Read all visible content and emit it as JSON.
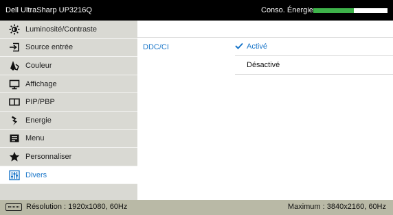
{
  "header": {
    "model": "Dell UltraSharp UP3216Q",
    "energy_label": "Conso. Énergie",
    "energy_level_percent": 55
  },
  "sidebar": {
    "items": [
      {
        "label": "Luminosité/Contraste",
        "icon": "brightness-icon"
      },
      {
        "label": "Source entrée",
        "icon": "input-source-icon"
      },
      {
        "label": "Couleur",
        "icon": "color-icon"
      },
      {
        "label": "Affichage",
        "icon": "display-icon"
      },
      {
        "label": "PIP/PBP",
        "icon": "pip-pbp-icon"
      },
      {
        "label": "Energie",
        "icon": "energy-icon"
      },
      {
        "label": "Menu",
        "icon": "menu-icon"
      },
      {
        "label": "Personnaliser",
        "icon": "star-icon"
      },
      {
        "label": "Divers",
        "icon": "equalizer-icon"
      }
    ],
    "active_index": 8
  },
  "content": {
    "setting": "DDC/CI",
    "options": [
      {
        "label": "Activé",
        "selected": true
      },
      {
        "label": "Désactivé",
        "selected": false
      }
    ]
  },
  "status": {
    "resolution": "Résolution : 1920x1080, 60Hz",
    "maximum": "Maximum : 3840x2160, 60Hz"
  },
  "colors": {
    "accent": "#1a76c9",
    "energy_fill": "#3eb24a",
    "sidebar_bg": "#d9d9d3",
    "statusbar_bg": "#b9b9a6"
  }
}
